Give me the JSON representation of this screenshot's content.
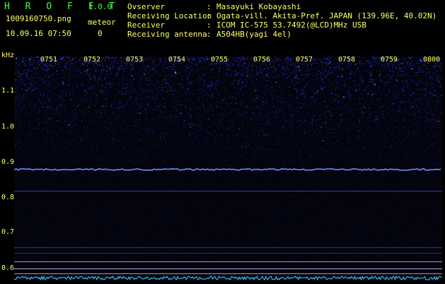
{
  "app": {
    "title": "H R O F F T",
    "version": "1.0.0"
  },
  "file": {
    "name": "1009160750.png",
    "datetime": "10.09.16 07:50"
  },
  "meteor": {
    "label": "meteor",
    "count": "0"
  },
  "metadata": [
    {
      "key": "Ovserver",
      "value": "Masayuki Kobayashi"
    },
    {
      "key": "Receiving Location",
      "value": "Ogata-vill. Akita-Pref. JAPAN (139.96E, 40.02N)"
    },
    {
      "key": "Receiver",
      "value": "ICOM IC-575 53.7492(@LCD)MHz USB"
    },
    {
      "key": "Receiving antenna",
      "value": "A504HB(yagi 4el)"
    }
  ],
  "axis": {
    "y_unit": "kHz",
    "y_ticks": [
      "1.1",
      "1.0",
      "0.9",
      "0.8",
      "0.7",
      "0.6"
    ],
    "x_ticks": [
      "0751",
      "0752",
      "0753",
      "0754",
      "0755",
      "0756",
      "0757",
      "0758",
      "0759",
      "0800"
    ]
  },
  "colors": {
    "text_yellow": "#ffff66",
    "text_green": "#3cff3c",
    "noise_blue": "#2a3cff",
    "carrier": "#6f8cff",
    "cyan_trace": "#3fd7ff"
  }
}
